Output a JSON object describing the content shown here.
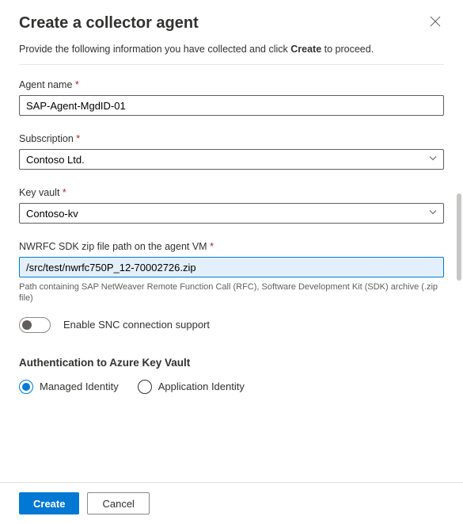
{
  "header": {
    "title": "Create a collector agent"
  },
  "intro": {
    "prefix": "Provide the following information you have collected and click ",
    "bold": "Create",
    "suffix": " to proceed."
  },
  "fields": {
    "agent_name": {
      "label": "Agent name",
      "value": "SAP-Agent-MgdID-01"
    },
    "subscription": {
      "label": "Subscription",
      "value": "Contoso Ltd."
    },
    "key_vault": {
      "label": "Key vault",
      "value": "Contoso-kv"
    },
    "sdk_path": {
      "label": "NWRFC SDK zip file path on the agent VM",
      "value": "/src/test/nwrfc750P_12-70002726.zip",
      "helper": "Path containing SAP NetWeaver Remote Function Call (RFC), Software Development Kit (SDK) archive (.zip file)"
    }
  },
  "toggle": {
    "label": "Enable SNC connection support",
    "value": false
  },
  "auth_section": {
    "title": "Authentication to Azure Key Vault",
    "options": [
      {
        "label": "Managed Identity",
        "selected": true
      },
      {
        "label": "Application Identity",
        "selected": false
      }
    ]
  },
  "footer": {
    "create": "Create",
    "cancel": "Cancel"
  }
}
